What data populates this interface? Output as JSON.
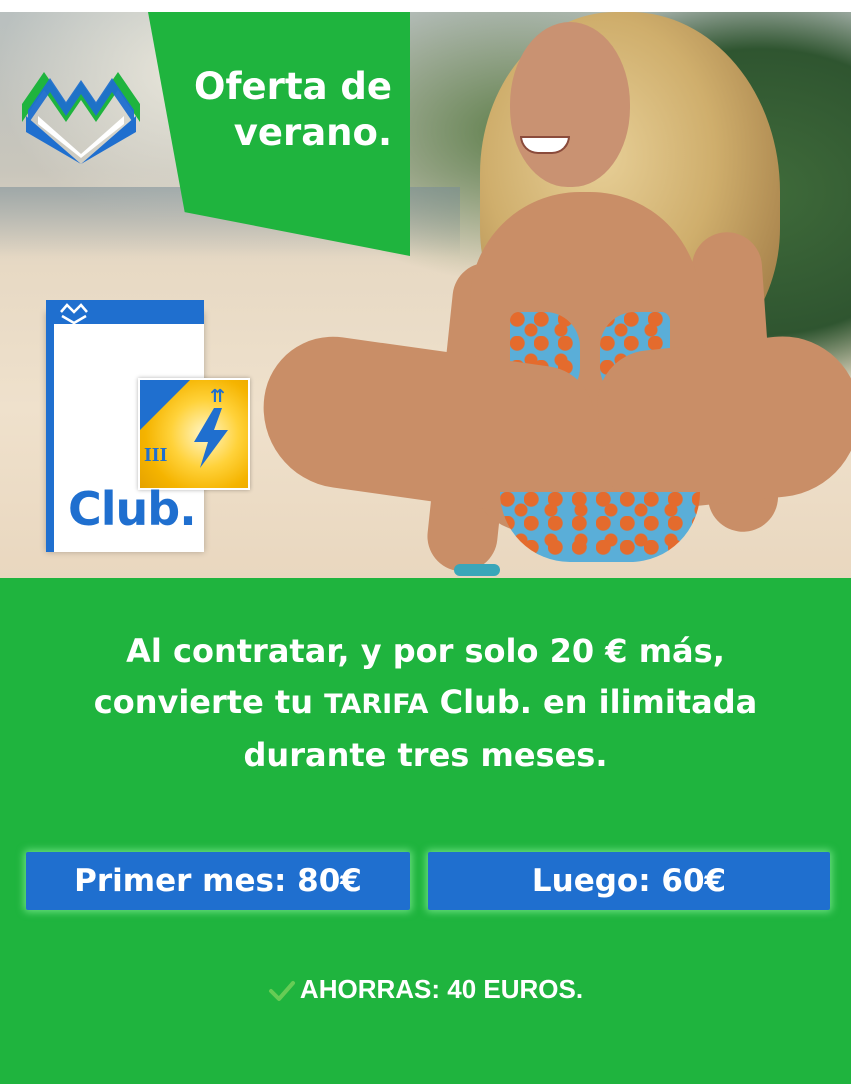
{
  "banner": {
    "line1": "Oferta de",
    "line2": "verano."
  },
  "product_box": {
    "label": "Club.",
    "sticker_numeral": "III",
    "sticker_arrows": "⇈"
  },
  "offer": {
    "line1": "Al contratar, y por solo 20 € más,",
    "line2_pre": "convierte tu ",
    "line2_tarifa": "TARIFA",
    "line2_post": " Club. en ilimitada",
    "line3": "durante tres meses."
  },
  "prices": {
    "first": "Primer mes: 80€",
    "then": "Luego: 60€"
  },
  "savings": {
    "text": "AHORRAS: 40 EUROS."
  },
  "colors": {
    "brand_green": "#1fb43e",
    "brand_blue": "#1f6fcf",
    "accent_light_green": "#66cc55"
  },
  "icons": [
    "mountain-logo-icon",
    "check-icon",
    "lightning-bolt-icon"
  ]
}
